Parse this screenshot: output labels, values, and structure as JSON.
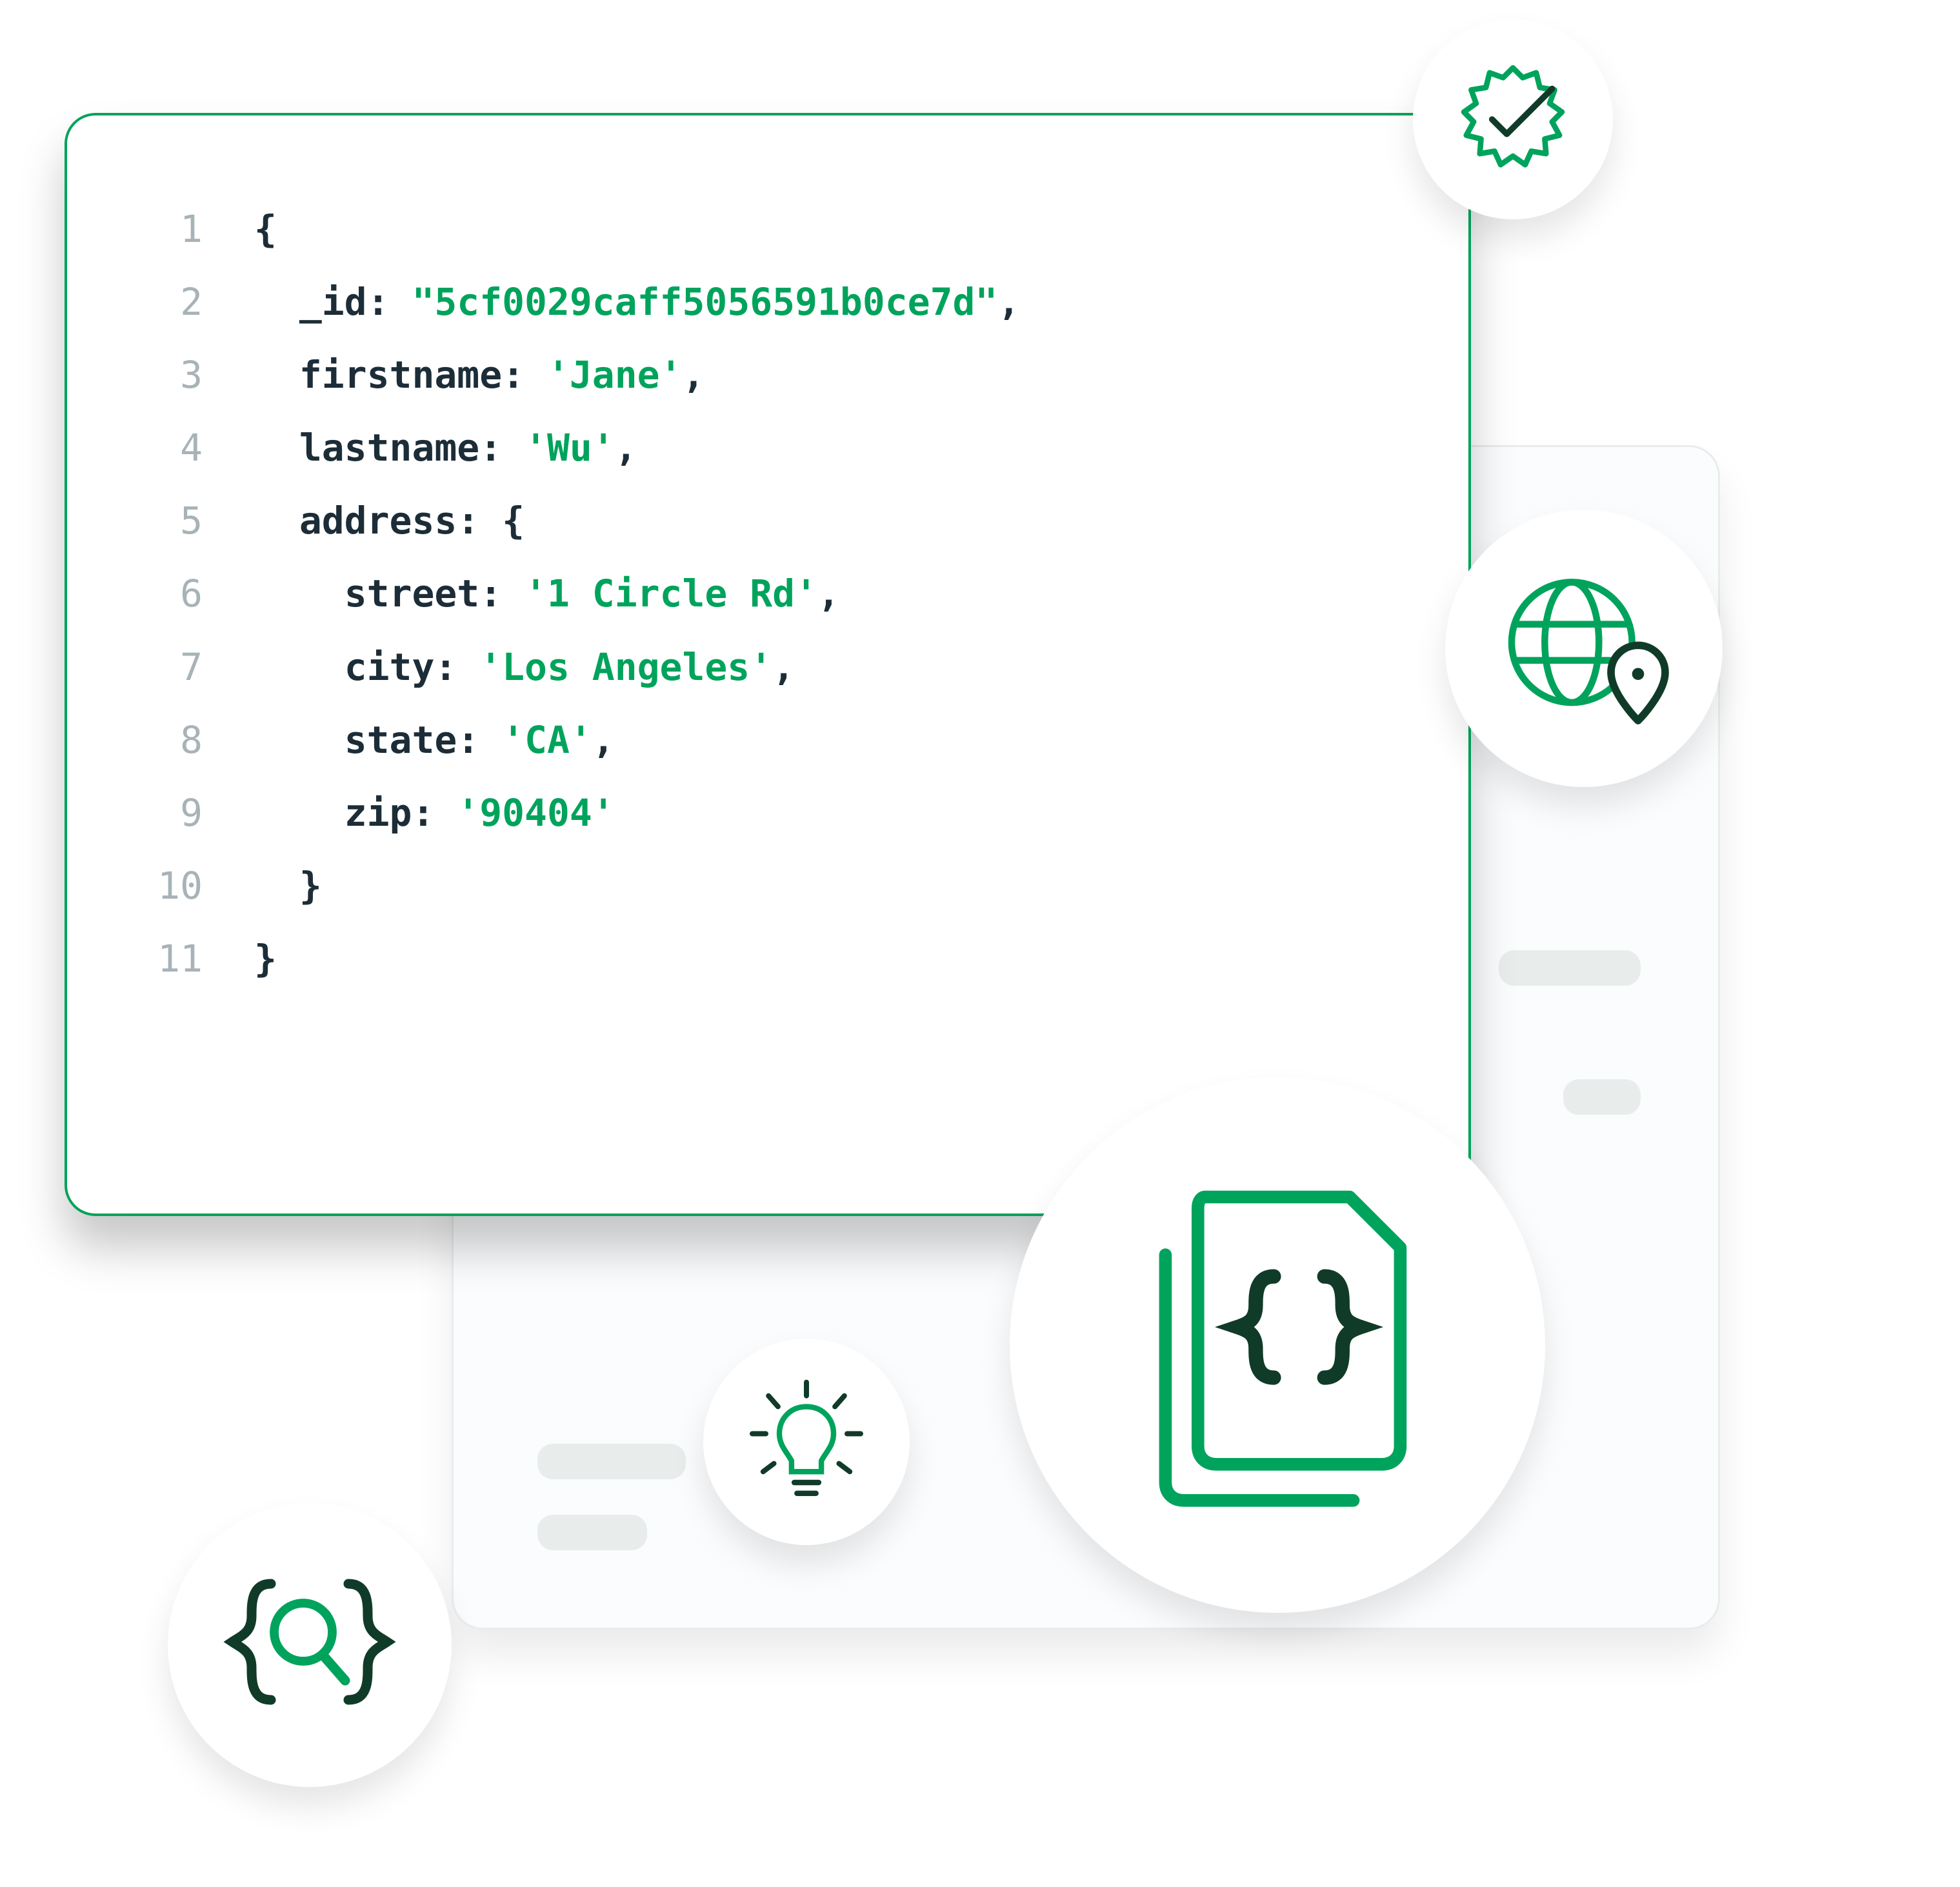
{
  "editor": {
    "lines": {
      "l1": "1",
      "l2": "2",
      "l3": "3",
      "l4": "4",
      "l5": "5",
      "l6": "6",
      "l7": "7",
      "l8": "8",
      "l9": "9",
      "l10": "10",
      "l11": "11"
    },
    "tokens": {
      "open_brace": "{",
      "close_brace": "}",
      "id_key": "_id: ",
      "id_val": "\"5cf0029caff5056591b0ce7d\"",
      "comma": ",",
      "fn_key": "firstname: ",
      "fn_val": "'Jane'",
      "ln_key": "lastname: ",
      "ln_val": "'Wu'",
      "addr_key": "address: ",
      "addr_open": "{",
      "street_key": "street: ",
      "street_val": "'1 Circle Rd'",
      "city_key": "city: ",
      "city_val": "'Los Angeles'",
      "state_key": "state: ",
      "state_val": "'CA'",
      "zip_key": "zip: ",
      "zip_val": "'90404'",
      "addr_close": "}",
      "ind1": "  ",
      "ind2": "    "
    }
  },
  "icons": {
    "verify": "verified-badge-icon",
    "globe": "globe-location-icon",
    "document": "document-json-icon",
    "bulb": "lightbulb-icon",
    "brace_search": "brace-search-icon"
  },
  "colors": {
    "accent": "#00a35c",
    "dark": "#113b29"
  }
}
